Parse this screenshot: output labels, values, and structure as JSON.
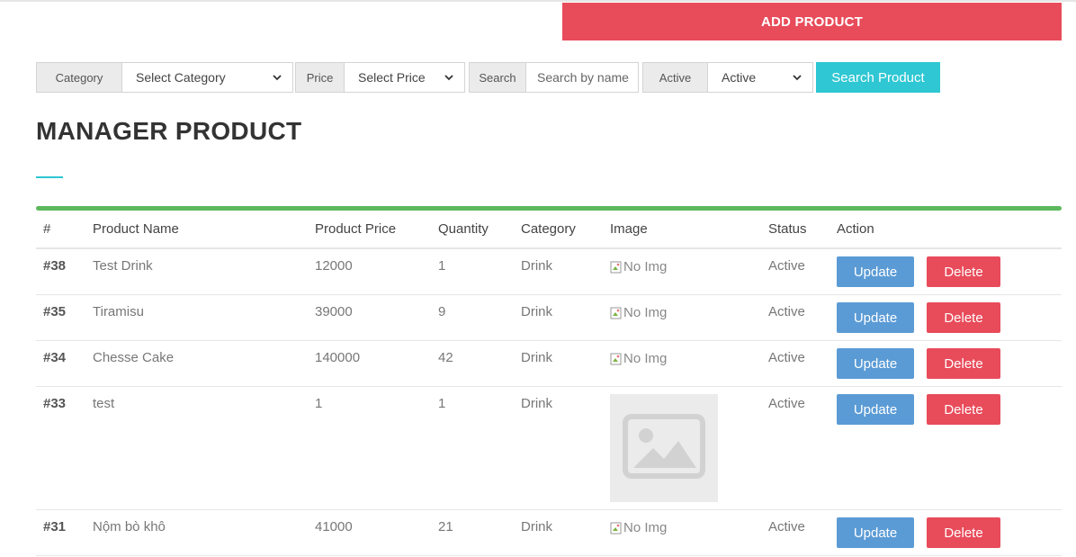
{
  "header": {
    "add_product_label": "ADD PRODUCT"
  },
  "filters": {
    "category_label": "Category",
    "category_selected": "Select Category",
    "price_label": "Price",
    "price_selected": "Select Price",
    "search_label": "Search",
    "search_placeholder": "Search by name",
    "search_value": "",
    "active_label": "Active",
    "active_selected": "Active",
    "search_button": "Search Product"
  },
  "page": {
    "title": "MANAGER PRODUCT"
  },
  "table": {
    "columns": [
      "#",
      "Product Name",
      "Product Price",
      "Quantity",
      "Category",
      "Image",
      "Status",
      "Action"
    ],
    "rows": [
      {
        "id": "#38",
        "name": "Test Drink",
        "price": "12000",
        "quantity": "1",
        "category": "Drink",
        "image_alt": "No Img",
        "image_kind": "broken",
        "status": "Active",
        "update_label": "Update",
        "delete_label": "Delete"
      },
      {
        "id": "#35",
        "name": "Tiramisu",
        "price": "39000",
        "quantity": "9",
        "category": "Drink",
        "image_alt": "No Img",
        "image_kind": "broken",
        "status": "Active",
        "update_label": "Update",
        "delete_label": "Delete"
      },
      {
        "id": "#34",
        "name": "Chesse Cake",
        "price": "140000",
        "quantity": "42",
        "category": "Drink",
        "image_alt": "No Img",
        "image_kind": "broken",
        "status": "Active",
        "update_label": "Update",
        "delete_label": "Delete"
      },
      {
        "id": "#33",
        "name": "test",
        "price": "1",
        "quantity": "1",
        "category": "Drink",
        "image_alt": "",
        "image_kind": "placeholder",
        "status": "Active",
        "update_label": "Update",
        "delete_label": "Delete"
      },
      {
        "id": "#31",
        "name": "Nộm bò khô",
        "price": "41000",
        "quantity": "21",
        "category": "Drink",
        "image_alt": "No Img",
        "image_kind": "broken",
        "status": "Active",
        "update_label": "Update",
        "delete_label": "Delete"
      }
    ]
  },
  "colors": {
    "danger": "#e84b5a",
    "info": "#2ec7d3",
    "primary": "#5b9bd5",
    "success": "#5cb85c"
  }
}
